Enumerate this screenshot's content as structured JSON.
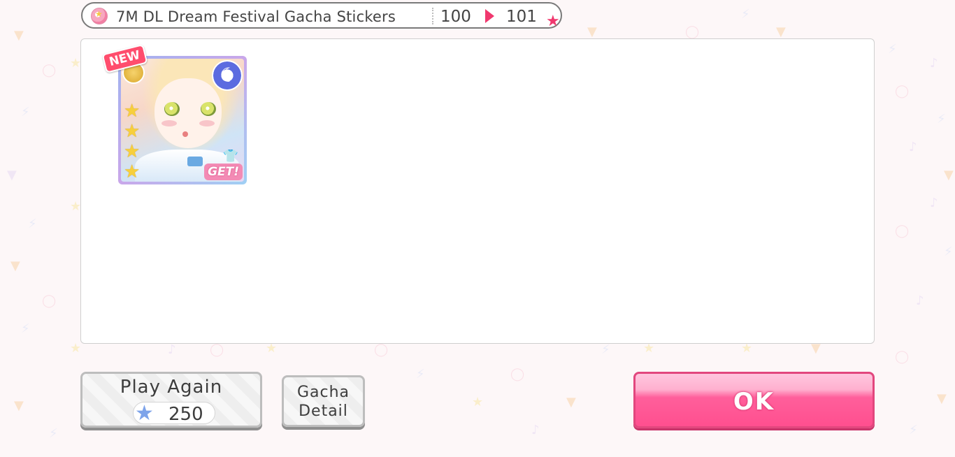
{
  "gacha": {
    "title": "7M DL Dream Festival Gacha Stickers",
    "count_before": "100",
    "count_after": "101",
    "ticket_icon": "gacha-ticket-icon",
    "arrow_icon": "play-arrow-icon",
    "star_icon": "pink-star-icon"
  },
  "result_card": {
    "new_label": "NEW",
    "get_label": "GET!",
    "rarity_stars": 4,
    "attribute_icon": "moon-icon",
    "band_icon": "band-emblem-icon",
    "shirt_icon": "costume-shirt-icon"
  },
  "buttons": {
    "play_again_label": "Play Again",
    "play_again_cost": "250",
    "play_again_cost_icon": "star-gem-icon",
    "gacha_detail_label_line1": "Gacha",
    "gacha_detail_label_line2": "Detail",
    "ok_label": "OK"
  },
  "colors": {
    "accent_pink": "#f0386e",
    "ok_button": "#ff4f8f",
    "background": "#fdf7f8"
  }
}
